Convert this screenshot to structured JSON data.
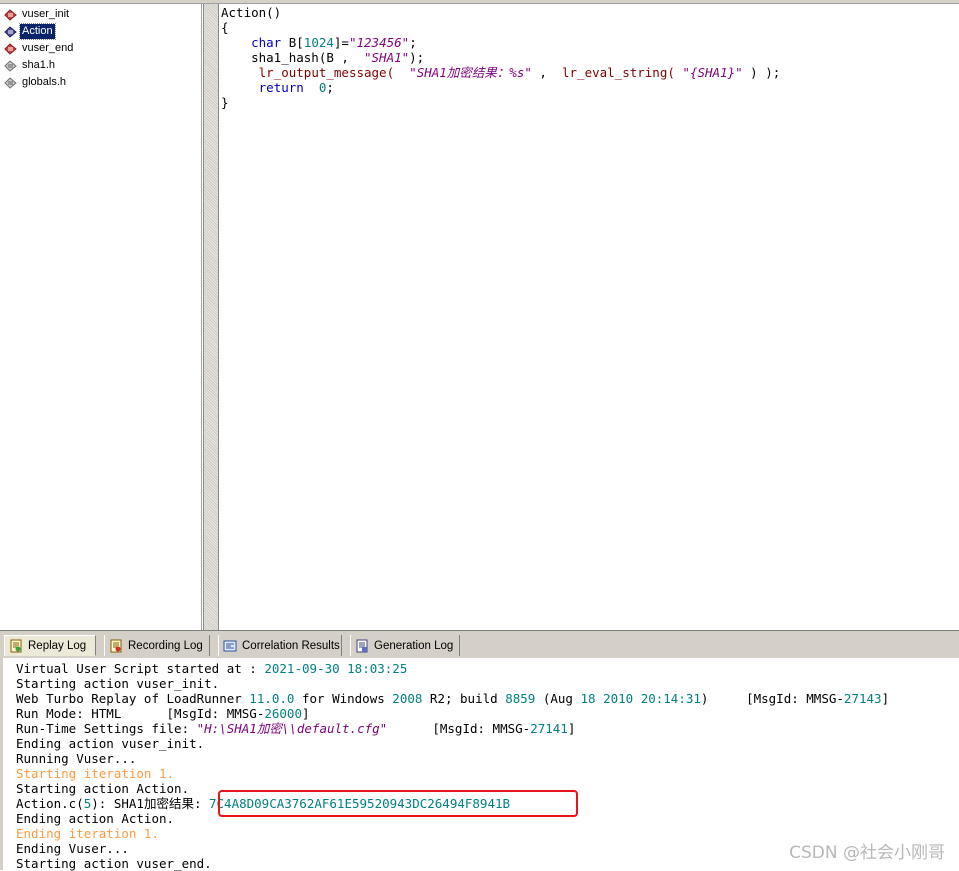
{
  "tree": {
    "items": [
      {
        "label": "vuser_init",
        "icon": "script-red-icon"
      },
      {
        "label": "Action",
        "icon": "script-action-icon"
      },
      {
        "label": "vuser_end",
        "icon": "script-red-icon"
      },
      {
        "label": "sha1.h",
        "icon": "header-file-icon"
      },
      {
        "label": "globals.h",
        "icon": "header-file-icon"
      }
    ],
    "selected": "Action"
  },
  "editor": {
    "lines": [
      {
        "parts": [
          {
            "t": "Action()",
            "c": ""
          }
        ]
      },
      {
        "parts": [
          {
            "t": "{",
            "c": ""
          }
        ]
      },
      {
        "parts": [
          {
            "t": "    ",
            "c": ""
          },
          {
            "t": "char",
            "c": "kw"
          },
          {
            "t": " B[",
            "c": ""
          },
          {
            "t": "1024",
            "c": "num"
          },
          {
            "t": "]=",
            "c": ""
          },
          {
            "t": "\"123456\"",
            "c": "str"
          },
          {
            "t": ";",
            "c": ""
          }
        ]
      },
      {
        "parts": [
          {
            "t": "    sha1_hash(B ,  ",
            "c": ""
          },
          {
            "t": "\"SHA1\"",
            "c": "str"
          },
          {
            "t": ");",
            "c": ""
          }
        ]
      },
      {
        "parts": [
          {
            "t": "     ",
            "c": ""
          },
          {
            "t": "lr_output_message(",
            "c": "fn"
          },
          {
            "t": "  ",
            "c": ""
          },
          {
            "t": "\"SHA1加密结果：%s\"",
            "c": "str"
          },
          {
            "t": " ,  ",
            "c": ""
          },
          {
            "t": "lr_eval_string(",
            "c": "fn"
          },
          {
            "t": " ",
            "c": ""
          },
          {
            "t": "\"{SHA1}\"",
            "c": "str"
          },
          {
            "t": " ) );",
            "c": ""
          }
        ]
      },
      {
        "parts": [
          {
            "t": "     ",
            "c": ""
          },
          {
            "t": "return",
            "c": "kw"
          },
          {
            "t": "  ",
            "c": ""
          },
          {
            "t": "0",
            "c": "num"
          },
          {
            "t": ";",
            "c": ""
          }
        ]
      },
      {
        "parts": [
          {
            "t": "}",
            "c": ""
          }
        ]
      }
    ]
  },
  "tabs": [
    {
      "label": "Replay Log",
      "icon": "replay-log-icon",
      "active": true
    },
    {
      "label": "Recording Log",
      "icon": "recording-log-icon",
      "active": false
    },
    {
      "label": "Correlation Results",
      "icon": "correlation-icon",
      "active": false
    },
    {
      "label": "Generation Log",
      "icon": "generation-log-icon",
      "active": false
    }
  ],
  "log": {
    "lines": [
      {
        "parts": [
          {
            "t": "Virtual User Script started at : ",
            "c": ""
          },
          {
            "t": "2021-09-30 18:03:25",
            "c": "blue"
          }
        ]
      },
      {
        "parts": [
          {
            "t": "Starting action vuser_init.",
            "c": ""
          }
        ]
      },
      {
        "parts": [
          {
            "t": "Web Turbo Replay of LoadRunner ",
            "c": ""
          },
          {
            "t": "11.0.0",
            "c": "blue"
          },
          {
            "t": " for Windows ",
            "c": ""
          },
          {
            "t": "2008",
            "c": "blue"
          },
          {
            "t": " R2; build ",
            "c": ""
          },
          {
            "t": "8859",
            "c": "blue"
          },
          {
            "t": " (Aug ",
            "c": ""
          },
          {
            "t": "18",
            "c": "blue"
          },
          {
            "t": " ",
            "c": ""
          },
          {
            "t": "2010",
            "c": "blue"
          },
          {
            "t": " ",
            "c": ""
          },
          {
            "t": "20:14:31",
            "c": "blue"
          },
          {
            "t": ")     [MsgId: MMSG-",
            "c": ""
          },
          {
            "t": "27143",
            "c": "blue"
          },
          {
            "t": "]",
            "c": ""
          }
        ]
      },
      {
        "parts": [
          {
            "t": "Run Mode: HTML      [MsgId: MMSG-",
            "c": ""
          },
          {
            "t": "26000",
            "c": "blue"
          },
          {
            "t": "]",
            "c": ""
          }
        ]
      },
      {
        "parts": [
          {
            "t": "Run-Time Settings file: ",
            "c": ""
          },
          {
            "t": "\"H:\\SHA1加密\\\\default.cfg\"",
            "c": "path"
          },
          {
            "t": "      [MsgId: MMSG-",
            "c": ""
          },
          {
            "t": "27141",
            "c": "blue"
          },
          {
            "t": "]",
            "c": ""
          }
        ]
      },
      {
        "parts": [
          {
            "t": "Ending action vuser_init.",
            "c": ""
          }
        ]
      },
      {
        "parts": [
          {
            "t": "Running Vuser...",
            "c": ""
          }
        ]
      },
      {
        "parts": [
          {
            "t": "Starting iteration 1.",
            "c": "orange"
          }
        ]
      },
      {
        "parts": [
          {
            "t": "Starting action Action.",
            "c": ""
          }
        ]
      },
      {
        "parts": [
          {
            "t": "Action.c(",
            "c": ""
          },
          {
            "t": "5",
            "c": "blue"
          },
          {
            "t": "): SHA1加密结果: ",
            "c": ""
          },
          {
            "t": "7C4A8D09CA3762AF61E59520943DC26494F8941B",
            "c": "hash"
          }
        ]
      },
      {
        "parts": [
          {
            "t": "Ending action Action.",
            "c": ""
          }
        ]
      },
      {
        "parts": [
          {
            "t": "Ending iteration 1.",
            "c": "orange"
          }
        ]
      },
      {
        "parts": [
          {
            "t": "Ending Vuser...",
            "c": ""
          }
        ]
      },
      {
        "parts": [
          {
            "t": "Starting action vuser_end.",
            "c": ""
          }
        ]
      }
    ]
  },
  "watermark": "CSDN @社会小刚哥"
}
